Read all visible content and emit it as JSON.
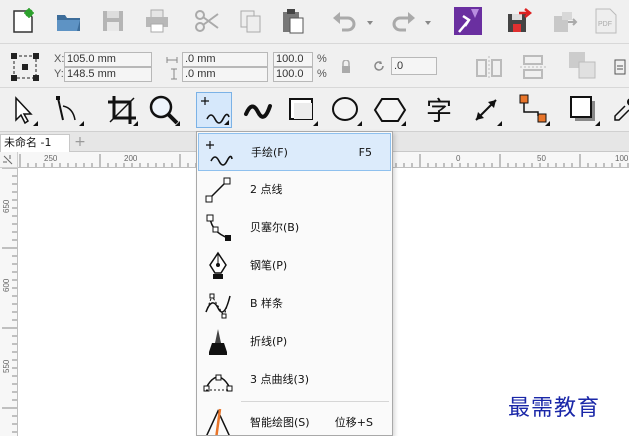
{
  "property_bar": {
    "x_label": "X:",
    "x_value": "105.0 mm",
    "y_label": "Y:",
    "y_value": "148.5 mm",
    "w_value": ".0 mm",
    "h_value": ".0 mm",
    "scale_x": "100.0",
    "scale_y": "100.0",
    "pct_x": "%",
    "pct_y": "%",
    "rotate_value": ".0"
  },
  "document_tab": {
    "title": "未命名 -1",
    "add_label": "+"
  },
  "ruler": {
    "horizontal_ticks": [
      "250",
      "200",
      "0",
      "50",
      "100"
    ],
    "vertical_ticks": [
      "650",
      "600",
      "550"
    ]
  },
  "flyout_menu": {
    "items": [
      {
        "label": "手绘(F)",
        "shortcut": "F5",
        "icon": "freehand-icon"
      },
      {
        "label": "2 点线",
        "shortcut": "",
        "icon": "two-point-line-icon"
      },
      {
        "label": "贝塞尔(B)",
        "shortcut": "",
        "icon": "bezier-icon"
      },
      {
        "label": "钢笔(P)",
        "shortcut": "",
        "icon": "pen-icon"
      },
      {
        "label": "B 样条",
        "shortcut": "",
        "icon": "b-spline-icon"
      },
      {
        "label": "折线(P)",
        "shortcut": "",
        "icon": "polyline-icon"
      },
      {
        "label": "3 点曲线(3)",
        "shortcut": "",
        "icon": "three-point-curve-icon"
      },
      {
        "label": "智能绘图(S)",
        "shortcut": "位移+S",
        "icon": "smart-drawing-icon"
      }
    ]
  },
  "watermark": {
    "text": "最需教育"
  },
  "colors": {
    "accent": "#7a3fb0",
    "selection_bg": "#dcebfb",
    "watermark": "#1a27a8",
    "orange": "#e8752a"
  }
}
